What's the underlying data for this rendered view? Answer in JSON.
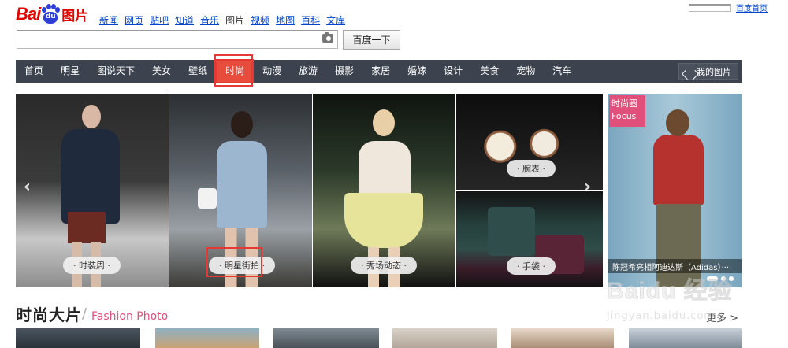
{
  "top": {
    "home_link": "百度首页"
  },
  "logo": {
    "bai": "Bai",
    "du": "du",
    "tupian": "图片"
  },
  "channels": [
    {
      "label": "新闻",
      "current": false
    },
    {
      "label": "网页",
      "current": false
    },
    {
      "label": "贴吧",
      "current": false
    },
    {
      "label": "知道",
      "current": false
    },
    {
      "label": "音乐",
      "current": false
    },
    {
      "label": "图片",
      "current": true
    },
    {
      "label": "视频",
      "current": false
    },
    {
      "label": "地图",
      "current": false
    },
    {
      "label": "百科",
      "current": false
    },
    {
      "label": "文库",
      "current": false
    }
  ],
  "search": {
    "value": "",
    "button_label": "百度一下"
  },
  "nav": {
    "items": [
      "首页",
      "明星",
      "图说天下",
      "美女",
      "壁纸",
      "时尚",
      "动漫",
      "旅游",
      "摄影",
      "家居",
      "婚嫁",
      "设计",
      "美食",
      "宠物",
      "汽车"
    ],
    "active": "时尚",
    "my_pics": "我的图片"
  },
  "gallery": {
    "tiles": [
      {
        "label": "· 时装周 ·"
      },
      {
        "label": "· 明星街拍 ·"
      },
      {
        "label": "· 秀场动态 ·"
      },
      {
        "label": "· 腕表 ·"
      },
      {
        "label": "· 手袋 ·"
      }
    ],
    "focus": {
      "badge_cn": "时尚圈",
      "badge_en": "Focus",
      "caption": "陈冠希亮相阿迪达斯（Adidas）···"
    },
    "prev_arrow": "‹",
    "next_arrow": "›"
  },
  "section": {
    "title": "时尚大片",
    "subtitle": "Fashion Photo",
    "more": "更多 >"
  },
  "watermark": {
    "main": "Baidu 经验",
    "sub": "jingyan.baidu.com"
  }
}
